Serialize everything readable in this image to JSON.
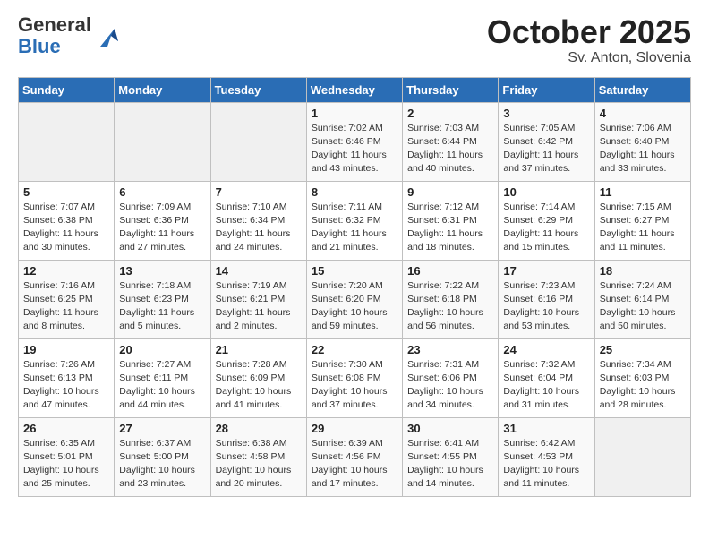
{
  "header": {
    "logo_general": "General",
    "logo_blue": "Blue",
    "month_title": "October 2025",
    "location": "Sv. Anton, Slovenia"
  },
  "weekdays": [
    "Sunday",
    "Monday",
    "Tuesday",
    "Wednesday",
    "Thursday",
    "Friday",
    "Saturday"
  ],
  "weeks": [
    [
      {
        "day": "",
        "info": ""
      },
      {
        "day": "",
        "info": ""
      },
      {
        "day": "",
        "info": ""
      },
      {
        "day": "1",
        "info": "Sunrise: 7:02 AM\nSunset: 6:46 PM\nDaylight: 11 hours\nand 43 minutes."
      },
      {
        "day": "2",
        "info": "Sunrise: 7:03 AM\nSunset: 6:44 PM\nDaylight: 11 hours\nand 40 minutes."
      },
      {
        "day": "3",
        "info": "Sunrise: 7:05 AM\nSunset: 6:42 PM\nDaylight: 11 hours\nand 37 minutes."
      },
      {
        "day": "4",
        "info": "Sunrise: 7:06 AM\nSunset: 6:40 PM\nDaylight: 11 hours\nand 33 minutes."
      }
    ],
    [
      {
        "day": "5",
        "info": "Sunrise: 7:07 AM\nSunset: 6:38 PM\nDaylight: 11 hours\nand 30 minutes."
      },
      {
        "day": "6",
        "info": "Sunrise: 7:09 AM\nSunset: 6:36 PM\nDaylight: 11 hours\nand 27 minutes."
      },
      {
        "day": "7",
        "info": "Sunrise: 7:10 AM\nSunset: 6:34 PM\nDaylight: 11 hours\nand 24 minutes."
      },
      {
        "day": "8",
        "info": "Sunrise: 7:11 AM\nSunset: 6:32 PM\nDaylight: 11 hours\nand 21 minutes."
      },
      {
        "day": "9",
        "info": "Sunrise: 7:12 AM\nSunset: 6:31 PM\nDaylight: 11 hours\nand 18 minutes."
      },
      {
        "day": "10",
        "info": "Sunrise: 7:14 AM\nSunset: 6:29 PM\nDaylight: 11 hours\nand 15 minutes."
      },
      {
        "day": "11",
        "info": "Sunrise: 7:15 AM\nSunset: 6:27 PM\nDaylight: 11 hours\nand 11 minutes."
      }
    ],
    [
      {
        "day": "12",
        "info": "Sunrise: 7:16 AM\nSunset: 6:25 PM\nDaylight: 11 hours\nand 8 minutes."
      },
      {
        "day": "13",
        "info": "Sunrise: 7:18 AM\nSunset: 6:23 PM\nDaylight: 11 hours\nand 5 minutes."
      },
      {
        "day": "14",
        "info": "Sunrise: 7:19 AM\nSunset: 6:21 PM\nDaylight: 11 hours\nand 2 minutes."
      },
      {
        "day": "15",
        "info": "Sunrise: 7:20 AM\nSunset: 6:20 PM\nDaylight: 10 hours\nand 59 minutes."
      },
      {
        "day": "16",
        "info": "Sunrise: 7:22 AM\nSunset: 6:18 PM\nDaylight: 10 hours\nand 56 minutes."
      },
      {
        "day": "17",
        "info": "Sunrise: 7:23 AM\nSunset: 6:16 PM\nDaylight: 10 hours\nand 53 minutes."
      },
      {
        "day": "18",
        "info": "Sunrise: 7:24 AM\nSunset: 6:14 PM\nDaylight: 10 hours\nand 50 minutes."
      }
    ],
    [
      {
        "day": "19",
        "info": "Sunrise: 7:26 AM\nSunset: 6:13 PM\nDaylight: 10 hours\nand 47 minutes."
      },
      {
        "day": "20",
        "info": "Sunrise: 7:27 AM\nSunset: 6:11 PM\nDaylight: 10 hours\nand 44 minutes."
      },
      {
        "day": "21",
        "info": "Sunrise: 7:28 AM\nSunset: 6:09 PM\nDaylight: 10 hours\nand 41 minutes."
      },
      {
        "day": "22",
        "info": "Sunrise: 7:30 AM\nSunset: 6:08 PM\nDaylight: 10 hours\nand 37 minutes."
      },
      {
        "day": "23",
        "info": "Sunrise: 7:31 AM\nSunset: 6:06 PM\nDaylight: 10 hours\nand 34 minutes."
      },
      {
        "day": "24",
        "info": "Sunrise: 7:32 AM\nSunset: 6:04 PM\nDaylight: 10 hours\nand 31 minutes."
      },
      {
        "day": "25",
        "info": "Sunrise: 7:34 AM\nSunset: 6:03 PM\nDaylight: 10 hours\nand 28 minutes."
      }
    ],
    [
      {
        "day": "26",
        "info": "Sunrise: 6:35 AM\nSunset: 5:01 PM\nDaylight: 10 hours\nand 25 minutes."
      },
      {
        "day": "27",
        "info": "Sunrise: 6:37 AM\nSunset: 5:00 PM\nDaylight: 10 hours\nand 23 minutes."
      },
      {
        "day": "28",
        "info": "Sunrise: 6:38 AM\nSunset: 4:58 PM\nDaylight: 10 hours\nand 20 minutes."
      },
      {
        "day": "29",
        "info": "Sunrise: 6:39 AM\nSunset: 4:56 PM\nDaylight: 10 hours\nand 17 minutes."
      },
      {
        "day": "30",
        "info": "Sunrise: 6:41 AM\nSunset: 4:55 PM\nDaylight: 10 hours\nand 14 minutes."
      },
      {
        "day": "31",
        "info": "Sunrise: 6:42 AM\nSunset: 4:53 PM\nDaylight: 10 hours\nand 11 minutes."
      },
      {
        "day": "",
        "info": ""
      }
    ]
  ]
}
